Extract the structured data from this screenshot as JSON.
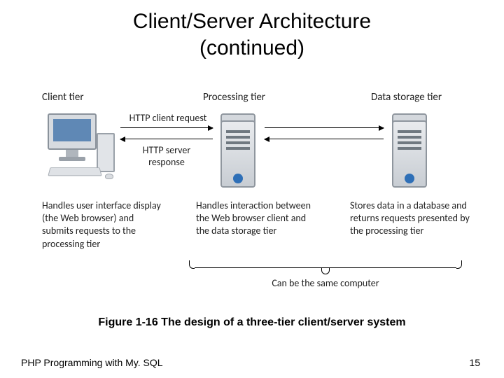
{
  "title_line1": "Client/Server Architecture",
  "title_line2": "(continued)",
  "tiers": {
    "client": {
      "label": "Client tier",
      "desc": "Handles user interface display (the Web browser) and submits requests to the processing tier"
    },
    "processing": {
      "label": "Processing tier",
      "desc": "Handles interaction between the Web browser client and the data storage tier"
    },
    "storage": {
      "label": "Data storage tier",
      "desc": "Stores data in a database and returns requests presented by the processing tier"
    }
  },
  "comm": {
    "request": "HTTP client request",
    "response": "HTTP server response"
  },
  "brace_label": "Can be the same computer",
  "caption": "Figure 1-16 The design of a three-tier client/server system",
  "footer": {
    "left": "PHP Programming with My. SQL",
    "page": "15"
  }
}
